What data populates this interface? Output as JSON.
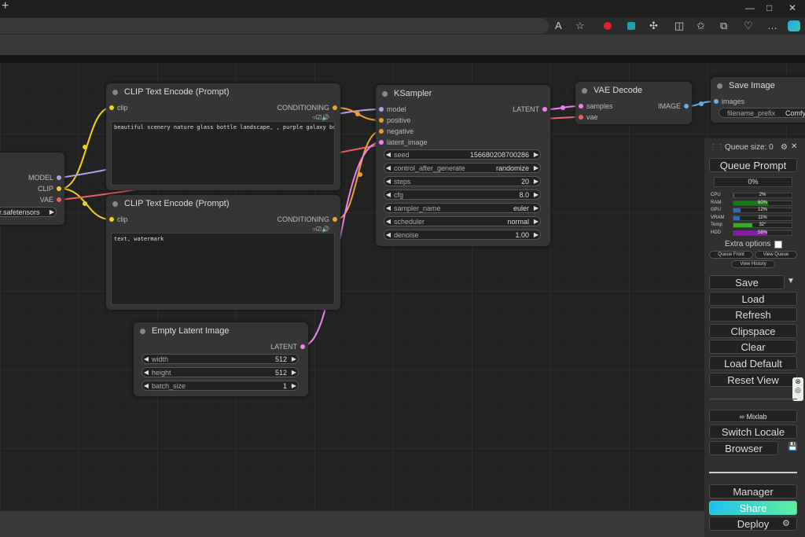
{
  "browser": {
    "new_tab_glyph": "+",
    "window_controls": [
      "—",
      "□",
      "✕"
    ],
    "toolbar_icons": [
      "read-aloud-icon",
      "favorite-icon",
      "extension-red-icon",
      "extension-teal-icon",
      "extensions-icon",
      "split-screen-icon",
      "favorites-icon",
      "collections-icon",
      "performance-icon",
      "more-icon",
      "copilot-icon"
    ]
  },
  "nodes": {
    "checkpoint": {
      "outputs": [
        "MODEL",
        "CLIP",
        "VAE"
      ],
      "ckpt_value": "r.safetensors"
    },
    "clip_pos": {
      "title": "CLIP Text Encode (Prompt)",
      "input": "clip",
      "output": "CONDITIONING",
      "text": "beautiful scenery nature glass bottle landscape, , purple galaxy bottle,"
    },
    "clip_neg": {
      "title": "CLIP Text Encode (Prompt)",
      "input": "clip",
      "output": "CONDITIONING",
      "text": "text, watermark"
    },
    "ksampler": {
      "title": "KSampler",
      "inputs": [
        "model",
        "positive",
        "negative",
        "latent_image"
      ],
      "output": "LATENT",
      "widgets": [
        {
          "label": "seed",
          "value": "156680208700286"
        },
        {
          "label": "control_after_generate",
          "value": "randomize"
        },
        {
          "label": "steps",
          "value": "20"
        },
        {
          "label": "cfg",
          "value": "8.0"
        },
        {
          "label": "sampler_name",
          "value": "euler"
        },
        {
          "label": "scheduler",
          "value": "normal"
        },
        {
          "label": "denoise",
          "value": "1.00"
        }
      ]
    },
    "vae_decode": {
      "title": "VAE Decode",
      "inputs": [
        "samples",
        "vae"
      ],
      "output": "IMAGE"
    },
    "save_image": {
      "title": "Save Image",
      "input": "images",
      "prefix_label": "filename_prefix",
      "prefix_value": "Comfy"
    },
    "empty_latent": {
      "title": "Empty Latent Image",
      "output": "LATENT",
      "widgets": [
        {
          "label": "width",
          "value": "512"
        },
        {
          "label": "height",
          "value": "512"
        },
        {
          "label": "batch_size",
          "value": "1"
        }
      ]
    }
  },
  "panel": {
    "queue_size": "Queue size: 0",
    "queue_prompt": "Queue Prompt",
    "progress": "0%",
    "stats": [
      {
        "label": "CPU",
        "value": "2%",
        "fill": 0.02,
        "color": "#2a8a2a"
      },
      {
        "label": "RAM",
        "value": "60%",
        "fill": 0.6,
        "color": "#1a7a1a"
      },
      {
        "label": "GPU",
        "value": "12%",
        "fill": 0.12,
        "color": "#1f6fd0"
      },
      {
        "label": "VRAM",
        "value": "11%",
        "fill": 0.11,
        "color": "#1f6fd0"
      },
      {
        "label": "Temp",
        "value": "32°",
        "fill": 0.32,
        "color": "#3aaa2a"
      },
      {
        "label": "HDD",
        "value": "58%",
        "fill": 0.58,
        "color": "#8a1aaa"
      }
    ],
    "extra_options": "Extra options",
    "queue_front": "Queue Front",
    "view_queue": "View Queue",
    "view_history": "View History",
    "save": "Save",
    "load": "Load",
    "refresh": "Refresh",
    "clipspace": "Clipspace",
    "clear": "Clear",
    "load_default": "Load Default",
    "reset_view": "Reset View",
    "mixlab": "∞ Mixlab",
    "switch_locale": "Switch Locale",
    "browser": "Browser",
    "manager": "Manager",
    "share": "Share",
    "deploy": "Deploy"
  },
  "colors": {
    "clip_wire": "#f0d020",
    "model_wire": "#b0a0f0",
    "vae_wire": "#f06060",
    "cond_wire": "#f0a030",
    "latent_wire": "#f080f0",
    "image_wire": "#60b0f0",
    "share_gradient": [
      "#20c0f0",
      "#60f0a0"
    ]
  }
}
